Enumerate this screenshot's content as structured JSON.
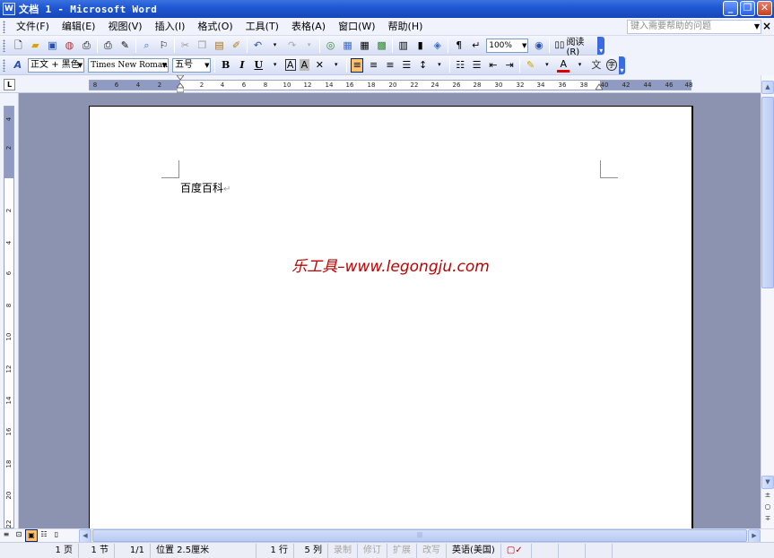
{
  "window": {
    "title": "文档 1 - Microsoft Word",
    "app_icon": "W",
    "minimize": "_",
    "maximize": "❐",
    "close": "✕"
  },
  "menu": {
    "items": [
      "文件(F)",
      "编辑(E)",
      "视图(V)",
      "插入(I)",
      "格式(O)",
      "工具(T)",
      "表格(A)",
      "窗口(W)",
      "帮助(H)"
    ],
    "help_placeholder": "键入需要帮助的问题",
    "close": "×"
  },
  "standard_toolbar": {
    "zoom": "100%",
    "read_label": "阅读(R)"
  },
  "formatting_toolbar": {
    "style": "正文 + 黑色",
    "font": "Times New Roman",
    "size": "五号",
    "bold": "B",
    "italic": "I",
    "underline": "U"
  },
  "ruler": {
    "tab_selector": "L",
    "left_numbers": [
      "8",
      "6",
      "4",
      "2"
    ],
    "right_numbers": [
      "2",
      "4",
      "6",
      "8",
      "10",
      "12",
      "14",
      "16",
      "18",
      "20",
      "22",
      "24",
      "26",
      "28",
      "30",
      "32",
      "34",
      "36",
      "38",
      "40",
      "42",
      "44",
      "46",
      "48"
    ],
    "vertical_numbers": [
      "4",
      "2",
      "2",
      "4",
      "6",
      "8",
      "10",
      "12",
      "14",
      "16",
      "18",
      "20",
      "22"
    ]
  },
  "document": {
    "text": "百度百科",
    "watermark": "乐工具–www.legongju.com"
  },
  "statusbar": {
    "page": "1 页",
    "section": "1 节",
    "page_of": "1/1",
    "position": "位置 2.5厘米",
    "line": "1 行",
    "column": "5 列",
    "rec": "录制",
    "trk": "修订",
    "ext": "扩展",
    "ovr": "改写",
    "language": "英语(美国)"
  }
}
